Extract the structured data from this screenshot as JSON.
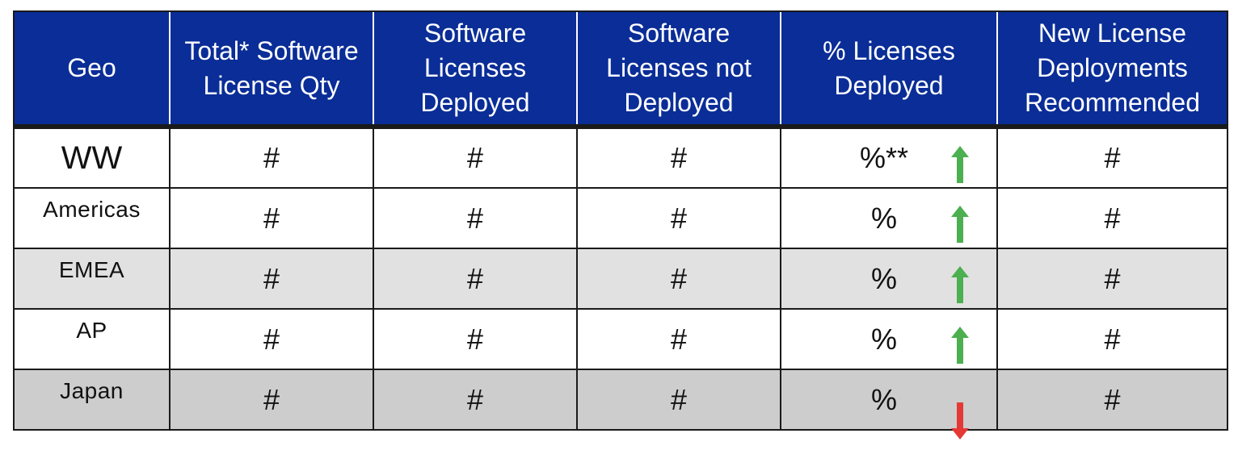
{
  "table": {
    "headers": [
      "Geo",
      "Total* Software License Qty",
      "Software Licenses Deployed",
      "Software Licenses not Deployed",
      "% Licenses Deployed",
      "New License Deployments Recommended"
    ],
    "rows": [
      {
        "geo": "WW",
        "total": "#",
        "deployed": "#",
        "not_deployed": "#",
        "pct": "%**",
        "trend": "up",
        "recommended": "#"
      },
      {
        "geo": "Americas",
        "total": "#",
        "deployed": "#",
        "not_deployed": "#",
        "pct": "%",
        "trend": "up",
        "recommended": "#"
      },
      {
        "geo": "EMEA",
        "total": "#",
        "deployed": "#",
        "not_deployed": "#",
        "pct": "%",
        "trend": "up",
        "recommended": "#"
      },
      {
        "geo": "AP",
        "total": "#",
        "deployed": "#",
        "not_deployed": "#",
        "pct": "%",
        "trend": "up",
        "recommended": "#"
      },
      {
        "geo": "Japan",
        "total": "#",
        "deployed": "#",
        "not_deployed": "#",
        "pct": "%",
        "trend": "down",
        "recommended": "#"
      }
    ]
  },
  "colors": {
    "header_bg": "#0a2d97",
    "up_arrow": "#4caf50",
    "down_arrow": "#e53935"
  },
  "icons": {
    "up": "arrow-up-icon",
    "down": "arrow-down-icon"
  }
}
